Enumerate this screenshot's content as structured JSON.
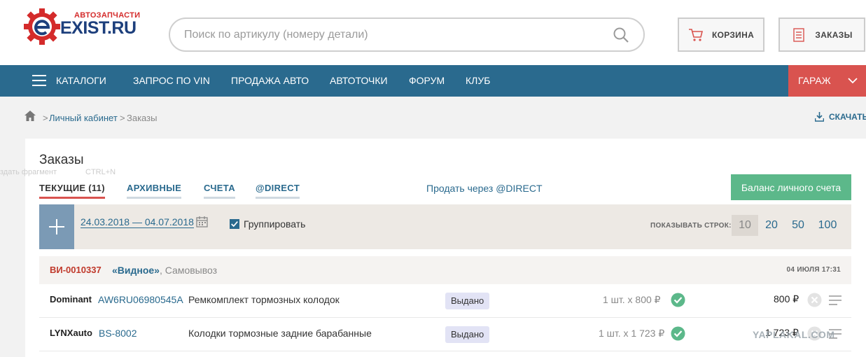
{
  "logo": {
    "small": "АВТОЗАПЧАСТИ",
    "main": "EXIST.RU"
  },
  "search": {
    "placeholder": "Поиск по артикулу (номеру детали)"
  },
  "header_buttons": {
    "cart": "КОРЗИНА",
    "orders": "ЗАКАЗЫ"
  },
  "nav": {
    "items": [
      "КАТАЛОГИ",
      "ЗАПРОС ПО VIN",
      "ПРОДАЖА АВТО",
      "АВТОТОЧКИ",
      "ФОРУМ",
      "КЛУБ"
    ],
    "garage": "ГАРАЖ",
    "color": "#2a6a8e",
    "garage_color": "#d9534f"
  },
  "breadcrumb": {
    "sep": ">",
    "items": [
      "Личный кабинет",
      "Заказы"
    ],
    "download": "СКАЧАТЬ"
  },
  "ghost_hint": {
    "text": "здать фрагмент",
    "key": "CTRL+N"
  },
  "page": {
    "title": "Заказы",
    "tabs": [
      "ТЕКУЩИЕ (11)",
      "АРХИВНЫЕ",
      "СЧЕТА",
      "@DIRECT"
    ],
    "active_tab": 0,
    "sell_link": "Продать через @DIRECT",
    "balance_button": "Баланс личного счета"
  },
  "filter": {
    "date_range": "24.03.2018 — 04.07.2018",
    "group_label": "Группировать",
    "group_checked": true,
    "rows_label": "ПОКАЗЫВАТЬ СТРОК:",
    "rows_options": [
      "10",
      "20",
      "50",
      "100"
    ],
    "rows_selected": "10"
  },
  "order": {
    "id": "ВИ-0010337",
    "shop": "«Видное»",
    "delivery": ", Самовывоз",
    "date": "04 ИЮЛЯ 17:31",
    "items": [
      {
        "brand": "Dominant",
        "article": "AW6RU06980545A",
        "description": "Ремкомплект тормозных колодок",
        "status": "Выдано",
        "qty": "1 шт. x 800 ₽",
        "price": "800 ₽"
      },
      {
        "brand": "LYNXauto",
        "article": "BS-8002",
        "description": "Колодки тормозные задние барабанные",
        "status": "Выдано",
        "qty": "1 шт. x 1 723 ₽",
        "price": "1 723 ₽"
      }
    ]
  },
  "watermark": "YAPLAKAL.COM"
}
